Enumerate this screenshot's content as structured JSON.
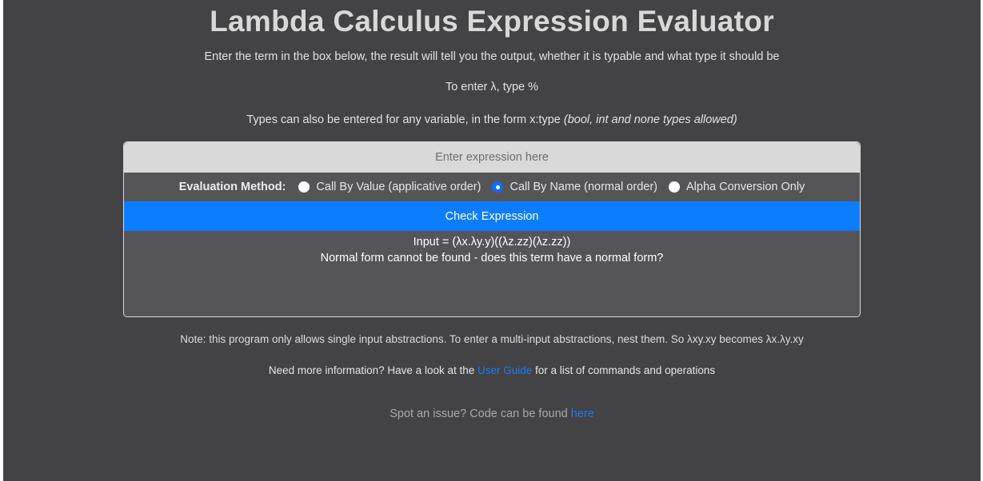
{
  "header": {
    "title": "Lambda Calculus Expression Evaluator",
    "subtitle": "Enter the term in the box below, the result will tell you the output, whether it is typable and what type it should be",
    "lambda_hint": "To enter λ, type %",
    "types_hint": "Types can also be entered for any variable, in the form x:type ",
    "types_hint_italic": "(bool, int and none types allowed)"
  },
  "form": {
    "input_placeholder": "Enter expression here",
    "input_value": "",
    "method_label": "Evaluation Method:",
    "methods": [
      {
        "label": "Call By Value (applicative order)",
        "checked": false
      },
      {
        "label": "Call By Name (normal order)",
        "checked": true
      },
      {
        "label": "Alpha Conversion Only",
        "checked": false
      }
    ],
    "check_button": "Check Expression"
  },
  "result": {
    "line1": "Input = (λx.λy.y)((λz.zz)(λz.zz))",
    "line2": "Normal form cannot be found - does this term have a normal form?"
  },
  "footer": {
    "note": "Note: this program only allows single input abstractions. To enter a multi-input abstractions, nest them. So λxy.xy becomes λx.λy.xy",
    "info_before": "Need more information? Have a look at the ",
    "info_link": "User Guide",
    "info_after": " for a list of commands and operations",
    "issue_before": "Spot an issue? Code can be found ",
    "issue_link": "here"
  },
  "colors": {
    "background": "#434345",
    "button": "#0d7dff",
    "link": "#1e7df0"
  }
}
